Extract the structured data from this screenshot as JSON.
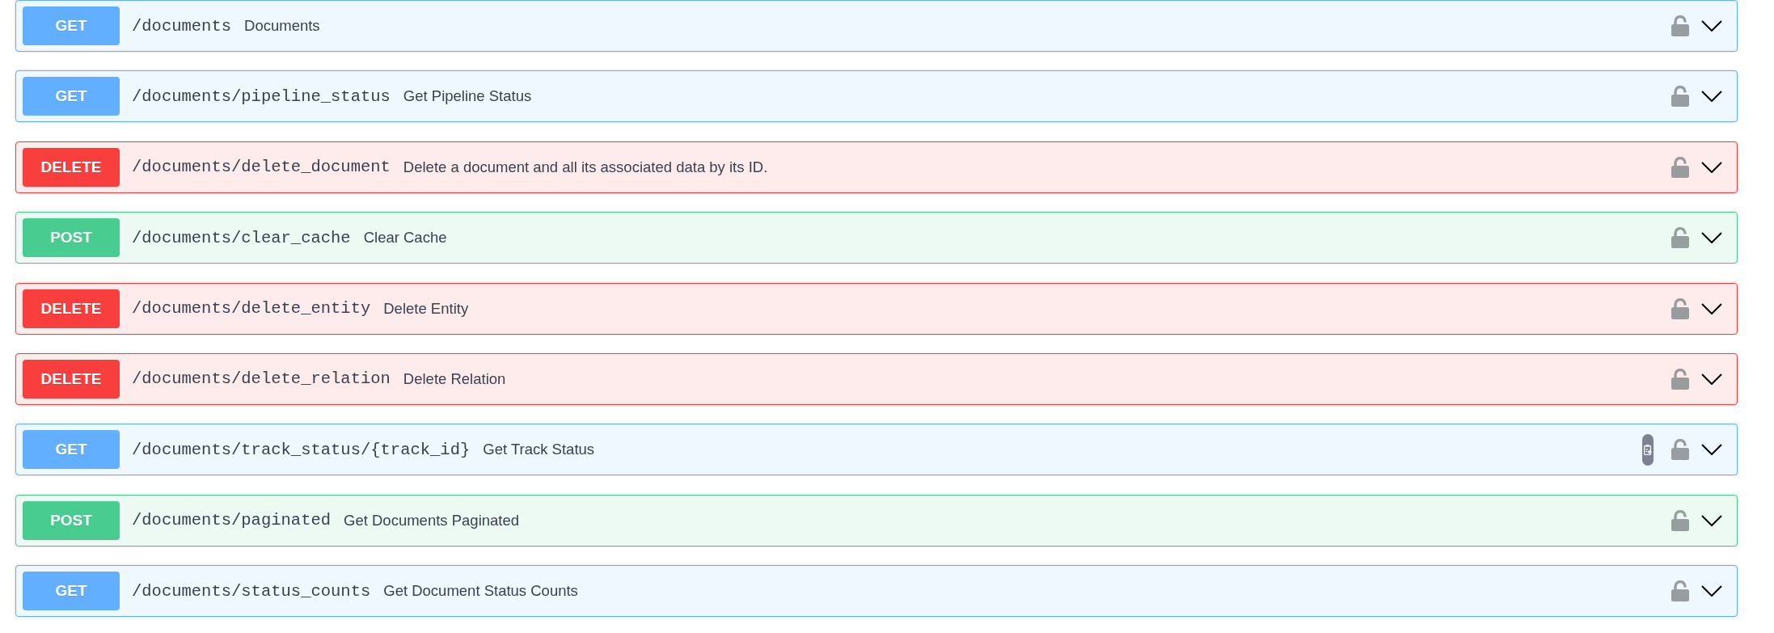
{
  "operations": [
    {
      "method": "GET",
      "color": "#61affe",
      "path": "/documents",
      "summary": "Documents",
      "copy_button": false,
      "locked": false,
      "expanded": false
    },
    {
      "method": "GET",
      "color": "#61affe",
      "path": "/documents/pipeline_status",
      "summary": "Get Pipeline Status",
      "copy_button": false,
      "locked": false,
      "expanded": false
    },
    {
      "method": "DELETE",
      "color": "#f93e3e",
      "path": "/documents/delete_document",
      "summary": "Delete a document and all its associated data by its ID.",
      "copy_button": false,
      "locked": false,
      "expanded": false
    },
    {
      "method": "POST",
      "color": "#49cc90",
      "path": "/documents/clear_cache",
      "summary": "Clear Cache",
      "copy_button": false,
      "locked": false,
      "expanded": false
    },
    {
      "method": "DELETE",
      "color": "#f93e3e",
      "path": "/documents/delete_entity",
      "summary": "Delete Entity",
      "copy_button": false,
      "locked": false,
      "expanded": false
    },
    {
      "method": "DELETE",
      "color": "#f93e3e",
      "path": "/documents/delete_relation",
      "summary": "Delete Relation",
      "copy_button": false,
      "locked": false,
      "expanded": false
    },
    {
      "method": "GET",
      "color": "#61affe",
      "path": "/documents/track_status/{track_id}",
      "summary": "Get Track Status",
      "copy_button": true,
      "locked": false,
      "expanded": false
    },
    {
      "method": "POST",
      "color": "#49cc90",
      "path": "/documents/paginated",
      "summary": "Get Documents Paginated",
      "copy_button": false,
      "locked": false,
      "expanded": false
    },
    {
      "method": "GET",
      "color": "#61affe",
      "path": "/documents/status_counts",
      "summary": "Get Document Status Counts",
      "copy_button": false,
      "locked": false,
      "expanded": false
    }
  ]
}
